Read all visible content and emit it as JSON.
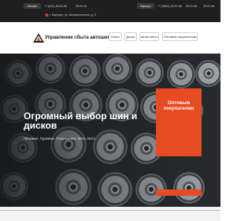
{
  "topbar": {
    "pill_left": "Москва",
    "phone_left": "+7 (812) 35-50-55",
    "hours_left": "09:00-20",
    "address": "г. Барнаул, ул. Воскресенского, д. 3",
    "pill_right": "Барнаул",
    "phone_right": "+7 (3852) 25-57-88",
    "phone_right2": "25-57-88",
    "phone_right3": "25-57-88"
  },
  "header": {
    "brand": "Управление сбыта автошин",
    "nav": [
      "Шины",
      "Диски",
      "Шины Мото",
      "Оптовым покупателям"
    ]
  },
  "hero": {
    "title": "Огромный выбор шин и дисков",
    "subtitle": "Легковые, Грузовые, Спецтехника, Мото, Мото"
  },
  "promo": {
    "label": "Оптовым покупателям"
  },
  "colors": {
    "accent": "#e84a22",
    "dark": "#1f1f1f"
  }
}
